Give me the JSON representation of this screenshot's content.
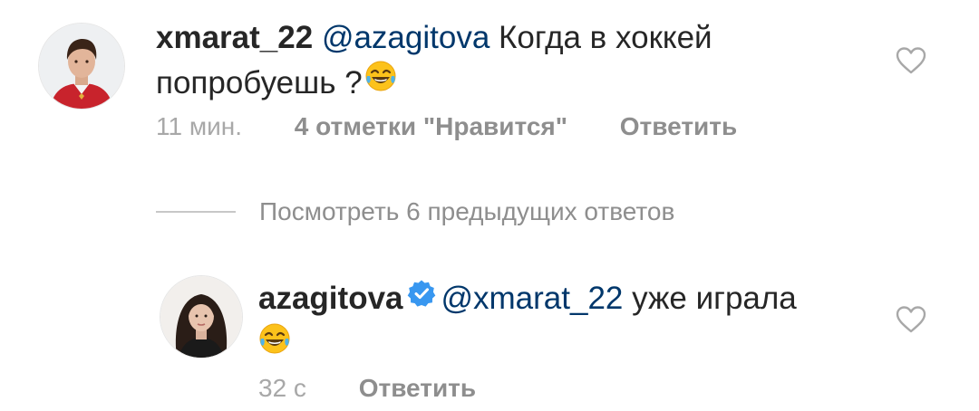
{
  "comment": {
    "username": "xmarat_22",
    "mention": "@azagitova",
    "text_line1": " Когда в хоккей",
    "text_line2": "попробуешь ?",
    "emoji": "face-with-tears-of-joy",
    "time": "11 мин.",
    "likes": "4 отметки \"Нравится\"",
    "reply": "Ответить",
    "like_icon": "heart-outline-icon"
  },
  "replies_toggle": {
    "label": "Посмотреть 6 предыдущих ответов"
  },
  "reply": {
    "username": "azagitova",
    "verified": true,
    "mention": "@xmarat_22",
    "text": " уже играла",
    "emoji": "face-with-tears-of-joy",
    "time": "32 с",
    "reply": "Ответить",
    "like_icon": "heart-outline-icon"
  },
  "colors": {
    "text": "#262626",
    "mention": "#00376b",
    "meta": "#8e8e8e",
    "verified": "#3897f0"
  }
}
